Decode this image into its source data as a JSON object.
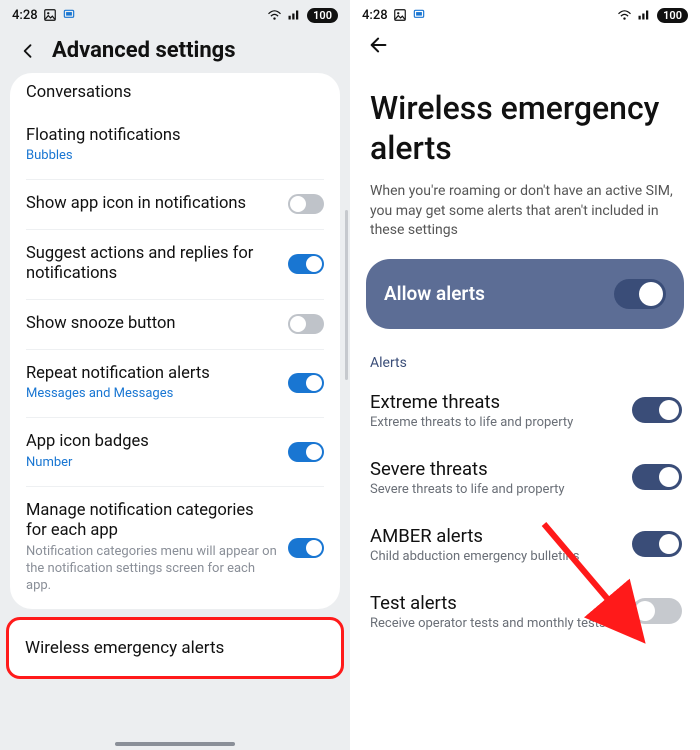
{
  "status": {
    "time": "4:28",
    "battery": "100"
  },
  "left": {
    "title": "Advanced settings",
    "rows": {
      "conversations": {
        "title": "Conversations"
      },
      "floating": {
        "title": "Floating notifications",
        "sub": "Bubbles"
      },
      "showicon": {
        "title": "Show app icon in notifications"
      },
      "suggest": {
        "title": "Suggest actions and replies for notifications"
      },
      "snooze": {
        "title": "Show snooze button"
      },
      "repeat": {
        "title": "Repeat notification alerts",
        "sub": "Messages and Messages"
      },
      "badges": {
        "title": "App icon badges",
        "sub": "Number"
      },
      "manage": {
        "title": "Manage notification categories for each app",
        "sub": "Notification categories menu will appear on the notification settings screen for each app."
      }
    },
    "wea": {
      "title": "Wireless emergency alerts"
    }
  },
  "right": {
    "title": "Wireless emergency alerts",
    "subtitle": "When you're roaming or don't have an active SIM, you may get some alerts that aren't included in these settings",
    "allow": "Allow alerts",
    "section": "Alerts",
    "items": {
      "extreme": {
        "title": "Extreme threats",
        "sub": "Extreme threats to life and property"
      },
      "severe": {
        "title": "Severe threats",
        "sub": "Severe threats to life and property"
      },
      "amber": {
        "title": "AMBER alerts",
        "sub": "Child abduction emergency bulletins"
      },
      "test": {
        "title": "Test alerts",
        "sub": "Receive operator tests and monthly tests"
      }
    }
  }
}
